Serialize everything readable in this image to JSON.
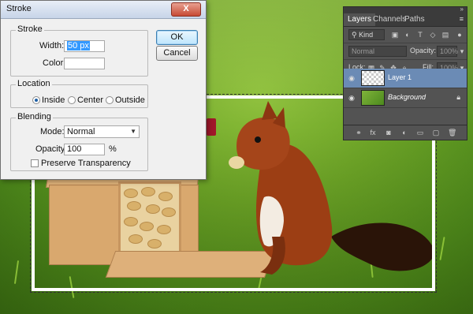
{
  "dialog": {
    "title": "Stroke",
    "close_glyph": "X",
    "stroke": {
      "group_label": "Stroke",
      "width_label": "Width:",
      "width_value": "50 px",
      "color_label": "Color:"
    },
    "location": {
      "group_label": "Location",
      "options": [
        "Inside",
        "Center",
        "Outside"
      ],
      "selected": "Inside"
    },
    "blending": {
      "group_label": "Blending",
      "mode_label": "Mode:",
      "mode_value": "Normal",
      "opacity_label": "Opacity:",
      "opacity_value": "100",
      "opacity_unit": "%",
      "preserve_label": "Preserve Transparency"
    },
    "ok_label": "OK",
    "cancel_label": "Cancel"
  },
  "layers_panel": {
    "tabs": [
      "Layers",
      "Channels",
      "Paths"
    ],
    "active_tab": "Layers",
    "filter_label": "Kind",
    "blend_mode": "Normal",
    "opacity_label": "Opacity:",
    "opacity_value": "100%",
    "lock_label": "Lock:",
    "fill_label": "Fill:",
    "fill_value": "100%",
    "layers": [
      {
        "name": "Layer 1",
        "selected": true
      },
      {
        "name": "Background",
        "selected": false,
        "locked": true
      }
    ]
  },
  "colors": {
    "selection_highlight": "#3399ff",
    "layer_selected": "#6b8bb5",
    "panel_bg": "#535353"
  }
}
